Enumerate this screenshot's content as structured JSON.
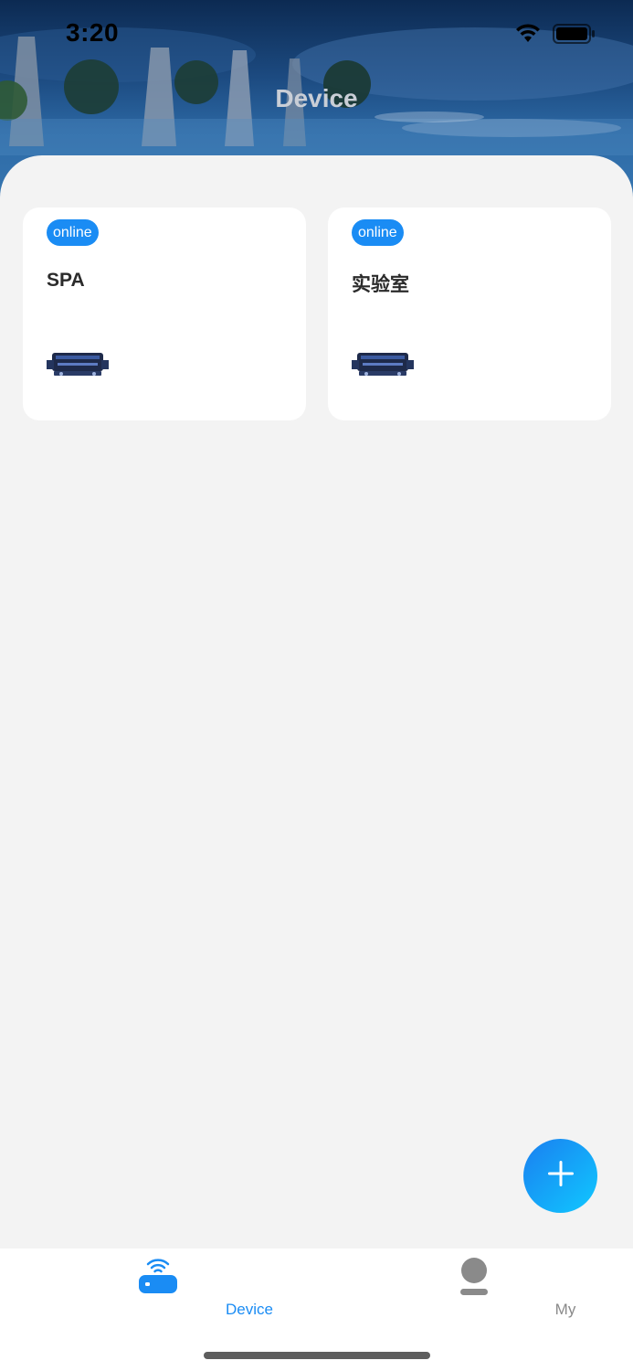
{
  "status_bar": {
    "time": "3:20"
  },
  "header": {
    "title": "Device"
  },
  "devices": [
    {
      "status": "online",
      "name": "SPA"
    },
    {
      "status": "online",
      "name": "实验室"
    }
  ],
  "tabs": [
    {
      "label": "Device",
      "active": true
    },
    {
      "label": "My",
      "active": false
    }
  ],
  "colors": {
    "accent": "#1a8cf4",
    "tab_inactive": "#8a8a8a",
    "background": "#f3f3f3"
  }
}
